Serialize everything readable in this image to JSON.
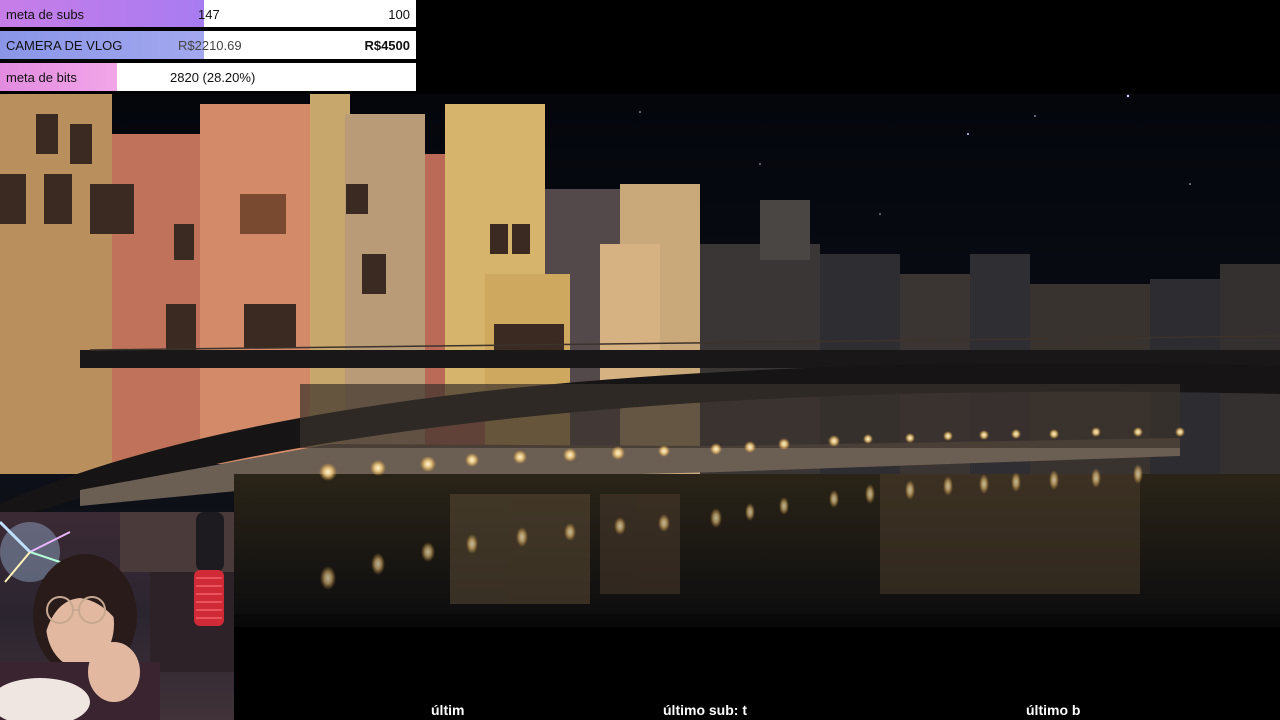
{
  "goals": {
    "subs": {
      "label": "meta de subs",
      "current": "147",
      "target": "100",
      "progress": 0.49
    },
    "camera": {
      "label": "CAMERA DE VLOG",
      "current": "R$2210.69",
      "target": "R$4500",
      "progress": 0.4913
    },
    "bits": {
      "label": "meta de bits",
      "current": "2820 (28.20%)",
      "progress": 0.282
    }
  },
  "ticker": {
    "item1": "últim",
    "item2": "último sub: t",
    "item3": "último b"
  },
  "colors": {
    "subs_fill": "#b77ce9",
    "camera_fill": "#8f9aea",
    "bits_fill": "#e795e3",
    "goal_background": "#ffffff"
  }
}
